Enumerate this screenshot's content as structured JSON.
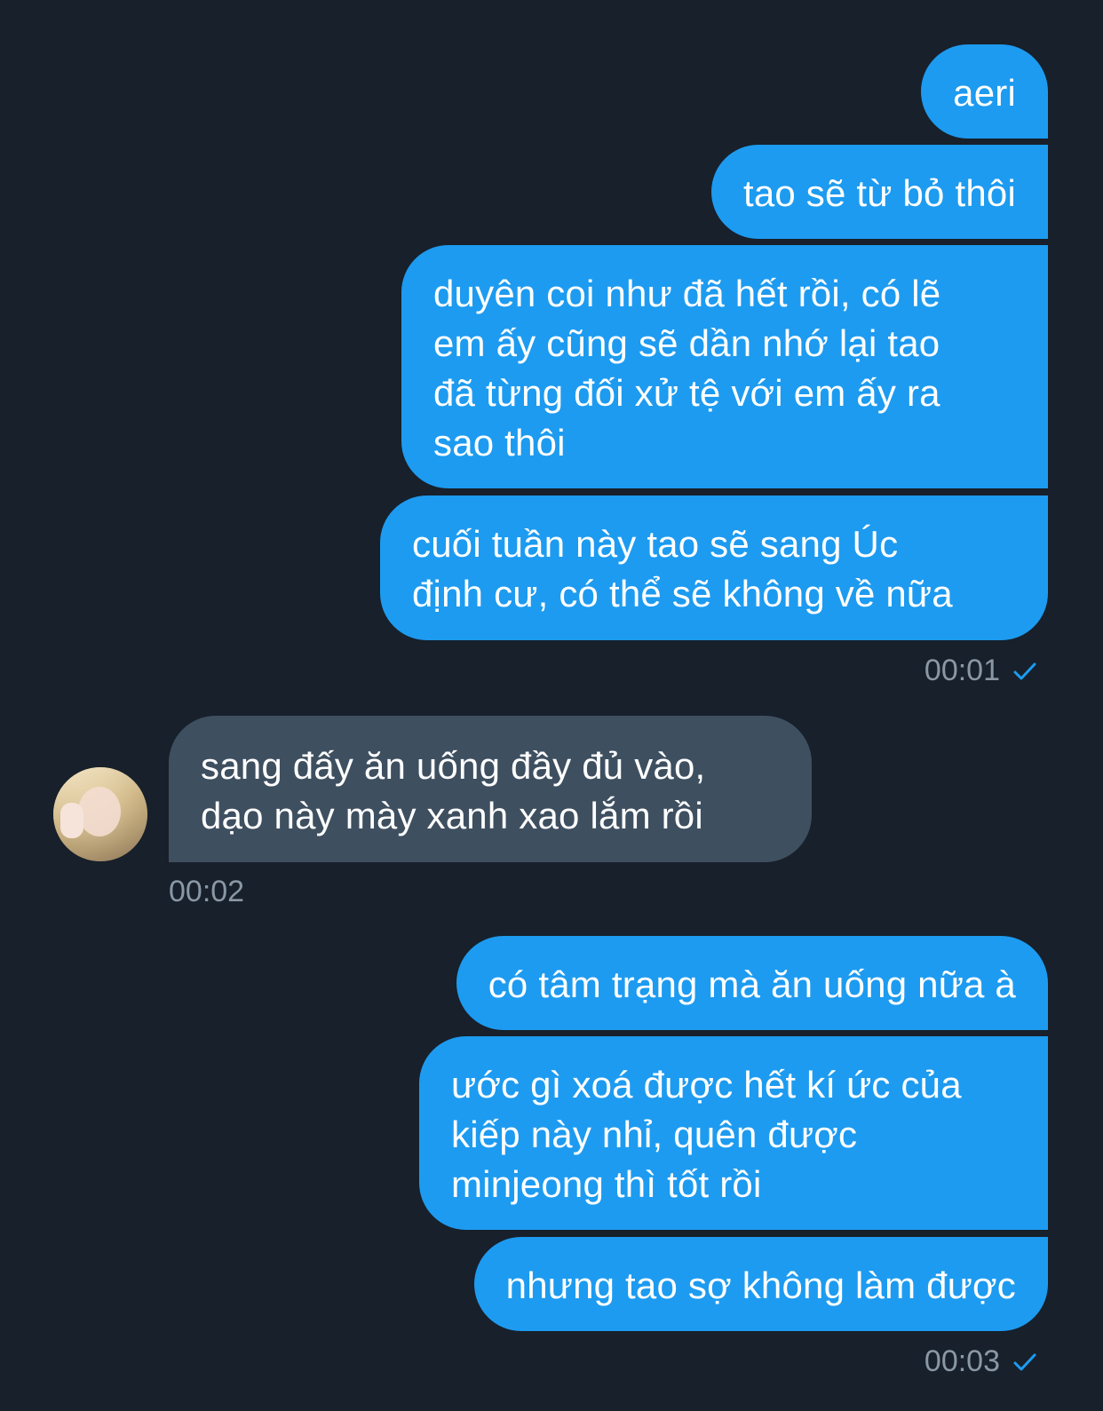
{
  "messages": {
    "m1": "aeri",
    "m2": "tao sẽ từ bỏ thôi",
    "m3": "duyên coi như đã hết rồi, có lẽ\nem ấy cũng sẽ dần nhớ lại tao\nđã từng đối xử tệ với em ấy ra\nsao thôi",
    "m4": "cuối tuần này tao sẽ sang Úc\nđịnh cư, có thể sẽ không về nữa",
    "time1": "00:01",
    "m5": "sang đấy ăn uống đầy đủ vào,\ndạo này mày xanh xao lắm rồi",
    "time2": "00:02",
    "m6": "có tâm trạng mà ăn uống nữa à",
    "m7": "ước gì xoá được hết kí ức của\nkiếp này nhỉ, quên được\nminjeong thì tốt rồi",
    "m8": "nhưng tao sợ không làm được",
    "time3": "00:03"
  },
  "colors": {
    "background": "#17202b",
    "outgoing_bubble": "#1d9bf0",
    "incoming_bubble": "#3e4f60",
    "timestamp": "#8a97a5",
    "read_check": "#1d9bf0"
  },
  "icons": {
    "read_receipt": "check-icon",
    "sender_avatar": "avatar"
  }
}
